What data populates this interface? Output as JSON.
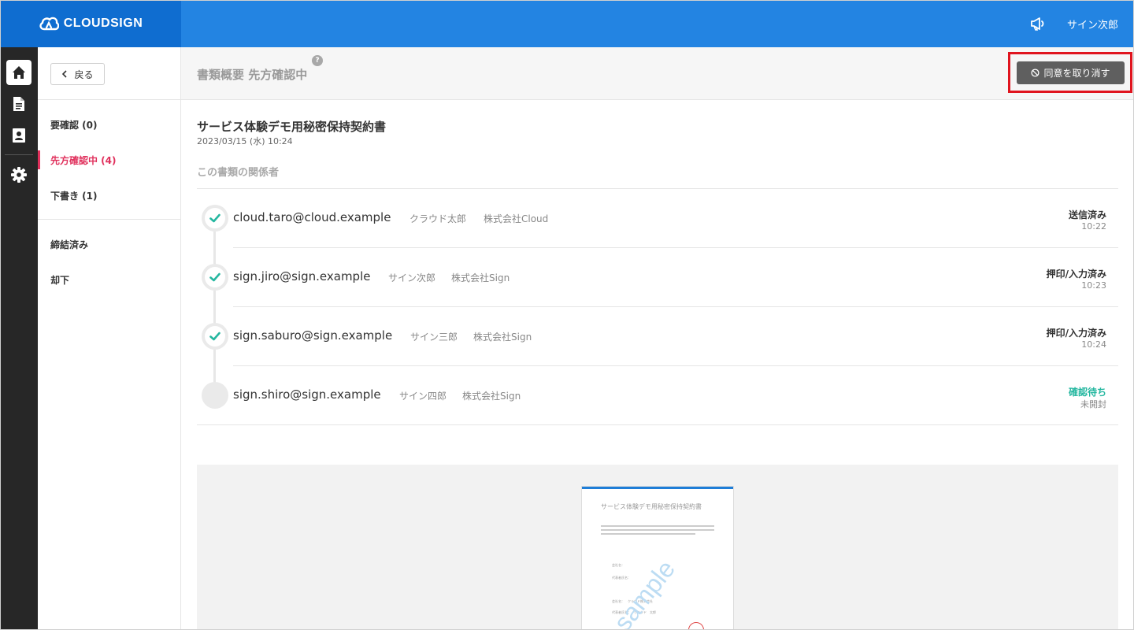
{
  "app": {
    "brand": "CLOUDSIGN",
    "user_name": "サイン次郎",
    "colors": {
      "topbar": "#2384e2",
      "brand_bg": "#0f6dd0",
      "rail": "#272727",
      "active_nav": "#e0305c",
      "check": "#25b7a0"
    }
  },
  "rail": {
    "items": [
      {
        "name": "home-icon",
        "active": true
      },
      {
        "name": "document-icon",
        "active": false
      },
      {
        "name": "contact-card-icon",
        "active": false
      },
      {
        "name": "gear-icon",
        "active": false
      }
    ]
  },
  "subnav": {
    "back_label": "戻る",
    "items": [
      {
        "label": "要確認 (0)",
        "active": false
      },
      {
        "label": "先方確認中 (4)",
        "active": true
      },
      {
        "label": "下書き (1)",
        "active": false
      },
      {
        "label": "締結済み",
        "active": false
      },
      {
        "label": "却下",
        "active": false
      }
    ]
  },
  "header": {
    "title": "書類概要 先方確認中",
    "help": "?",
    "revoke_label": "同意を取り消す"
  },
  "document": {
    "title": "サービス体験デモ用秘密保持契約書",
    "date": "2023/03/15 (水) 10:24",
    "participants_label": "この書類の関係者"
  },
  "participants": [
    {
      "email": "cloud.taro@cloud.example",
      "name": "クラウド太郎",
      "company": "株式会社Cloud",
      "status": "送信済み",
      "time": "10:22",
      "done": true
    },
    {
      "email": "sign.jiro@sign.example",
      "name": "サイン次郎",
      "company": "株式会社Sign",
      "status": "押印/入力済み",
      "time": "10:23",
      "done": true
    },
    {
      "email": "sign.saburo@sign.example",
      "name": "サイン三郎",
      "company": "株式会社Sign",
      "status": "押印/入力済み",
      "time": "10:24",
      "done": true
    },
    {
      "email": "sign.shiro@sign.example",
      "name": "サイン四郎",
      "company": "株式会社Sign",
      "status": "確認待ち",
      "time": "未開封",
      "done": false
    }
  ],
  "preview": {
    "title": "サービス体験デモ用秘密保持契約書",
    "watermark": "sample",
    "field_company": "会社名：",
    "field_rep": "代表者氏名：",
    "field_company_2": "会社名：　クラウド株式会社",
    "field_rep_2": "代表者氏名：　クラウド　太郎"
  }
}
